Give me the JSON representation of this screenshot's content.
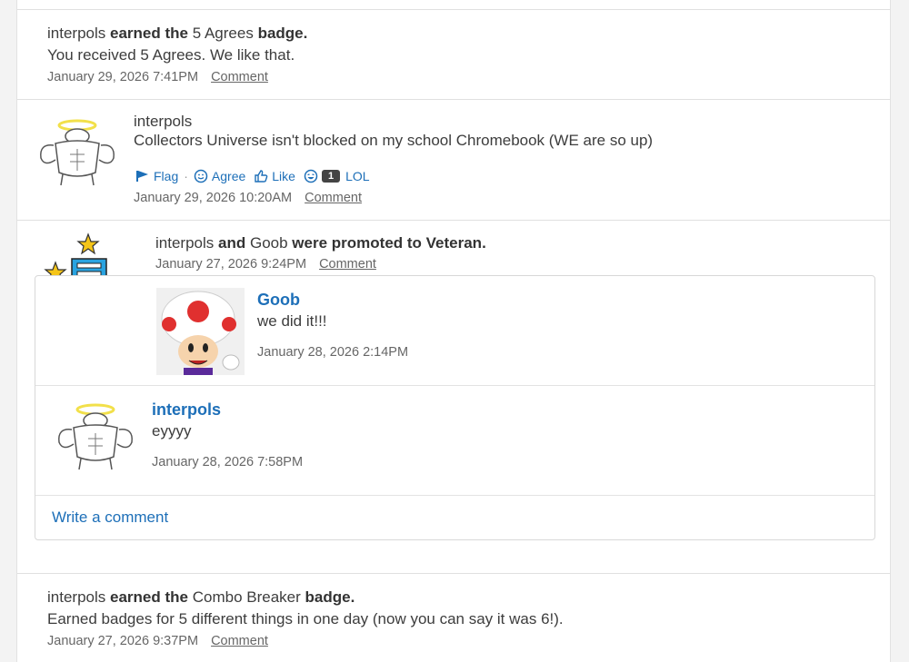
{
  "items": [
    {
      "user": "interpols",
      "verb": "earned the",
      "badge": "5 Agrees",
      "suffix": "badge.",
      "desc": "You received 5 Agrees. We like that.",
      "date": "January 29, 2026 7:41PM",
      "comment_label": "Comment"
    },
    {
      "user": "interpols",
      "text": "Collectors Universe isn't blocked on my school Chromebook (WE are so up)",
      "reactions": {
        "flag": "Flag",
        "agree": "Agree",
        "like": "Like",
        "lol_count": "1",
        "lol": "LOL"
      },
      "date": "January 29, 2026 10:20AM",
      "comment_label": "Comment"
    },
    {
      "user1": "interpols",
      "and": "and",
      "user2": "Goob",
      "action": "were promoted to Veteran.",
      "date": "January 27, 2026 9:24PM",
      "comment_label": "Comment",
      "comments": [
        {
          "author": "Goob",
          "text": "we did it!!!",
          "date": "January 28, 2026 2:14PM"
        },
        {
          "author": "interpols",
          "text": "eyyyy",
          "date": "January 28, 2026 7:58PM"
        }
      ],
      "write_comment": "Write a comment"
    },
    {
      "user": "interpols",
      "verb": "earned the",
      "badge": "Combo Breaker",
      "suffix": "badge.",
      "desc": "Earned badges for 5 different things in one day (now you can say it was 6!).",
      "date": "January 27, 2026 9:37PM",
      "comment_label": "Comment"
    }
  ],
  "colors": {
    "link": "#1d6fb8",
    "count_badge": "#444444",
    "star": "#f5c518",
    "toad_red": "#e0302f"
  }
}
